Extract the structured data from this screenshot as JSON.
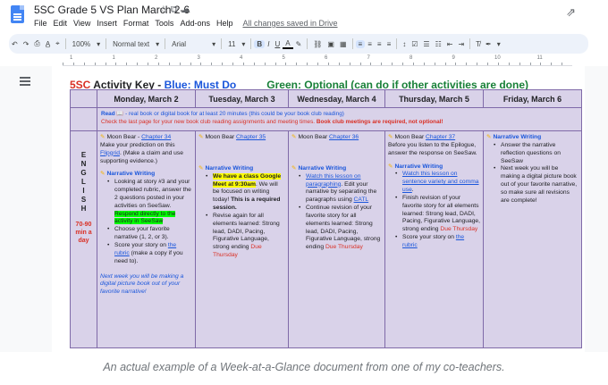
{
  "app": {
    "title": "5SC Grade 5 VS Plan March 2-6",
    "title_icons": "☆ ⧉ ☁",
    "menus": [
      "File",
      "Edit",
      "View",
      "Insert",
      "Format",
      "Tools",
      "Add-ons",
      "Help"
    ],
    "saved_status": "All changes saved in Drive",
    "trend_icon": "⇗"
  },
  "toolbar": {
    "zoom": "100%",
    "style": "Normal text",
    "font": "Arial",
    "size": "11"
  },
  "ruler": {
    "ticks": [
      "1",
      "1",
      "2",
      "3",
      "4",
      "5",
      "6",
      "7",
      "8",
      "9",
      "10",
      "11"
    ]
  },
  "heading": {
    "part1": "5SC",
    "part2": " Activity Key - ",
    "part3": "Blue: Must Do",
    "part4": "Green: Optional (can do if other activities are done)"
  },
  "table": {
    "days": [
      "Monday, March 2",
      "Tuesday, March 3",
      "Wednesday, March 4",
      "Thursday, March 5",
      "Friday, March 6"
    ],
    "read_label": "Read",
    "read_line1": " 📖 - real book or digital book for at least 20 minutes (this could be your book club reading)",
    "read_line2": "Check the last page for your new book club reading assignments and meeting times. ",
    "read_line2_bold": "Book club meetings are required, not optional!",
    "subject_letters": [
      "E",
      "N",
      "G",
      "L",
      "I",
      "S",
      "H"
    ],
    "subject_minutes": "70-90 min a day",
    "monday": {
      "mb_label": "Moon Bear - ",
      "mb_link": "Chapter 34",
      "mb_text1": "Make your prediction on this ",
      "mb_link2": "Flipgrid",
      "mb_text2": ". (Make a claim and use supporting evidence.)",
      "nw_label": "Narrative Writing",
      "b1a": "Looking at story #3 and your completed rubric, answer the 2 questions posted in your activities on SeeSaw. ",
      "b1b": "Respond directly to the activity in SeeSaw",
      "b2": "Choose your favorite narrative (1, 2, or 3).",
      "b3a": "Score your story on ",
      "b3b": "the rubric",
      "b3c": " (make a copy if you need to).",
      "note": "Next week you will be making a digital picture book out of your favorite narrative!"
    },
    "tuesday": {
      "mb_label": "Moon Bear ",
      "mb_link": "Chapter 35",
      "nw_label": "Narrative Writing",
      "b1a": "We have a class Google Meet at 9:30am",
      "b1b": ". We will be focused on writing today! ",
      "b1c": "This is a required session.",
      "b2a": "Revise again for all elements learned: Strong lead, DADI, Pacing, Figurative Language, strong ending ",
      "b2b": "Due Thursday"
    },
    "wednesday": {
      "mb_label": "Moon Bear ",
      "mb_link": "Chapter 36",
      "nw_label": "Narrative Writing",
      "b1a": "Watch this lesson on paragraphing",
      "b1b": ". Edit your narrative by separating the paragraphs using ",
      "b1c": "CATL",
      "b2a": "Continue revision of your favorite story for all elements learned: Strong lead, DADI, Pacing, Figurative Language, strong ending ",
      "b2b": "Due Thursday"
    },
    "thursday": {
      "mb_label": "Moon Bear ",
      "mb_link": "Chapter 37",
      "mb_text": "Before you listen to the Epilogue, answer the response on SeeSaw.",
      "nw_label": "Narrative Writing",
      "b1a": "Watch this lesson on sentence variety and comma use",
      "b1b": ".",
      "b2a": "Finish revision of your favorite story for all elements learned: Strong lead, DADI, Pacing, Figurative Language, strong ending ",
      "b2b": "Due Thursday",
      "b3a": "Score your story on ",
      "b3b": "the rubric"
    },
    "friday": {
      "nw_label": "Narrative Writing",
      "b1": "Answer the narrative reflection questions on SeeSaw",
      "b2": "Next week you will be making a digital picture book out of your favorite narrative, so make sure all revisions are complete!"
    }
  },
  "caption": "An actual example of a Week-at-a-Glance document from one of my co-teachers.",
  "colors": {
    "accent_blue": "#1a56db",
    "red": "#d93025",
    "green": "#188038",
    "table_bg": "#d9d2e9"
  }
}
